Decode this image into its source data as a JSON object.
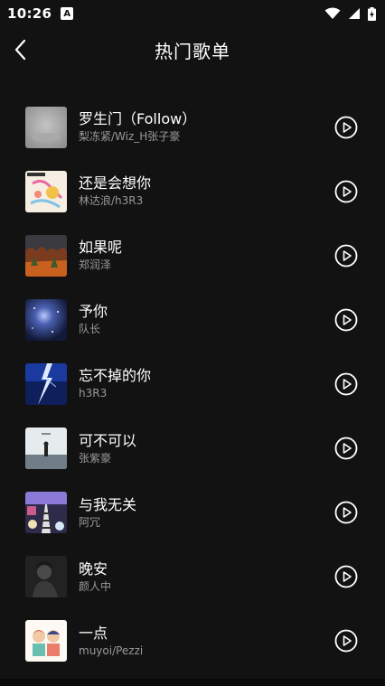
{
  "status": {
    "time": "10:26",
    "notif_letter": "A"
  },
  "header": {
    "title": "热门歌单"
  },
  "songs": [
    {
      "title": "罗生门（Follow）",
      "artist": "梨冻紧/Wiz_H张子豪",
      "cover": "gray-fog"
    },
    {
      "title": "还是会想你",
      "artist": "林达浪/h3R3",
      "cover": "pastel-doodle"
    },
    {
      "title": "如果呢",
      "artist": "郑润泽",
      "cover": "autumn-forest"
    },
    {
      "title": "予你",
      "artist": "队长",
      "cover": "galaxy-blue"
    },
    {
      "title": "忘不掉的你",
      "artist": "h3R3",
      "cover": "lightning-blue"
    },
    {
      "title": "可不可以",
      "artist": "张紫豪",
      "cover": "figure-sky"
    },
    {
      "title": "与我无关",
      "artist": "阿冗",
      "cover": "railway-collage"
    },
    {
      "title": "晚安",
      "artist": "颜人中",
      "cover": "dark-portrait"
    },
    {
      "title": "一点",
      "artist": "muyoi/Pezzi",
      "cover": "cartoon-couple"
    }
  ]
}
